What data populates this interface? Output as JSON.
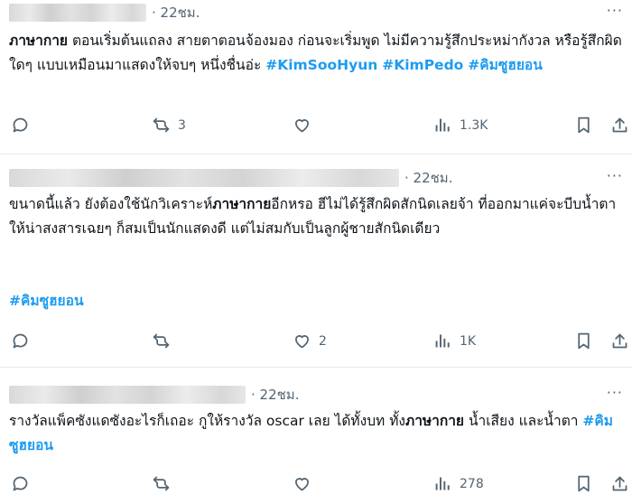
{
  "posts": [
    {
      "time": "· 22ชม.",
      "bold_word": "ภาษากาย",
      "text_after_bold": " ตอนเริ่มต้นแถลง สายตาตอนจ้องมอง ก่อนจะเริ่มพูด ไม่มีความรู้สึกประหม่ากังวล หรือรู้สึกผิดใดๆ แบบเหมือนมาแสดงให้จบๆ หนึ่งชื่นอ่ะ ",
      "hashtags": [
        "#KimSooHyun",
        "#KimPedo",
        "#คิมซูฮยอน"
      ],
      "stats": {
        "replies": "",
        "reposts": "3",
        "likes": "",
        "views": "1.3K"
      }
    },
    {
      "time": "· 22ชม.",
      "text_before_bold": "ขนาดนี้แล้ว ยังต้องใช้นักวิเคราะห์",
      "bold_word": "ภาษากาย",
      "text_after_bold": "อีกหรอ ฮีไม่ได้รู้สึกผิดสักนิดเลยจ้า ที่ออกมาแค่จะบีบน้ำตาให้น่าสงสารเฉยๆ ก็สมเป็นนักแสดงดี แต่ไม่สมกับเป็นลูกผู้ชายสักนิดเดียว",
      "hashtags": [
        "#คิมซูฮยอน"
      ],
      "stats": {
        "replies": "",
        "reposts": "",
        "likes": "2",
        "views": "1K"
      }
    },
    {
      "time": "· 22ชม.",
      "text_before_bold": "รางวัลแพ็คซังแดซังอะไรก็เถอะ กูให้รางวัล oscar เลย ได้ทั้งบท ทั้ง",
      "bold_word": "ภาษากาย",
      "text_after_bold": "น้ำเสียง และน้ำตา ",
      "hashtags": [
        "#คิมซูฮยอน"
      ],
      "stats": {
        "replies": "",
        "reposts": "",
        "likes": "",
        "views": "278"
      }
    }
  ],
  "icons": {
    "reply": "reply-icon",
    "repost": "repost-icon",
    "like": "heart-icon",
    "views": "views-icon",
    "bookmark": "bookmark-icon",
    "share": "share-icon",
    "more": "more-dots-icon"
  },
  "colors": {
    "hashtag": "#1d9bf0",
    "muted": "#536471",
    "text": "#0f1419",
    "divider": "#e6e9ec"
  }
}
